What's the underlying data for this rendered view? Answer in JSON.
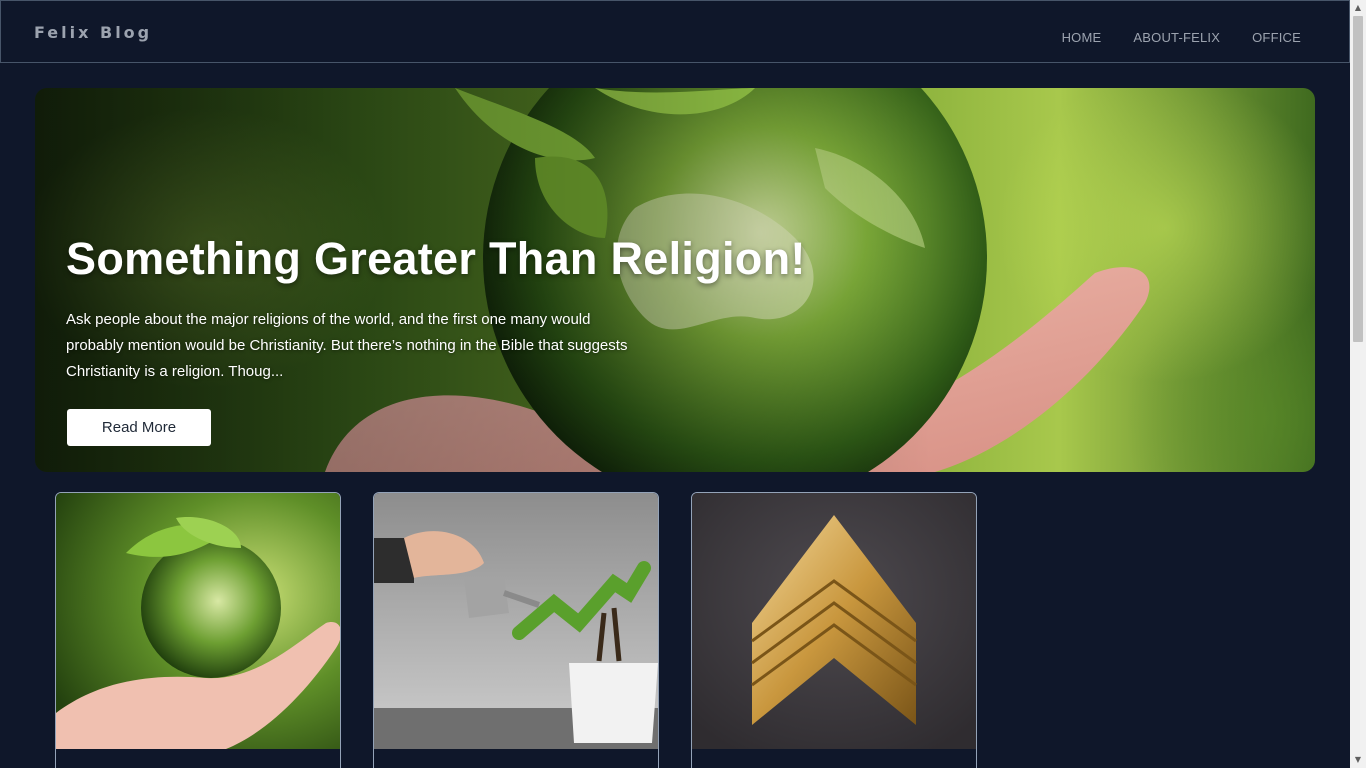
{
  "navbar": {
    "brand": "Felix Blog",
    "links": [
      "HOME",
      "ABOUT-FELIX",
      "OFFICE"
    ]
  },
  "hero": {
    "title": "Something Greater Than Religion!",
    "description": "Ask people about the major religions of the world, and the first one many would probably mention would be Christianity. But there’s nothing in the Bible that suggests Christianity is a religion. Thoug...",
    "button_label": "Read More"
  },
  "cards": [
    {
      "image": "globe-in-hand"
    },
    {
      "image": "watering-plant-growth"
    },
    {
      "image": "gold-chevron-rank"
    }
  ],
  "colors": {
    "background": "#0f172a",
    "nav_text": "#9ca3af",
    "button_bg": "#ffffff"
  }
}
